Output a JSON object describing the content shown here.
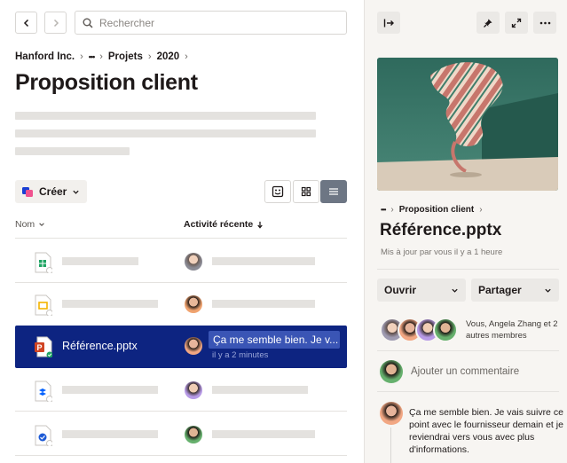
{
  "nav": {
    "back_icon": "chevron-left-icon",
    "forward_icon": "chevron-right-icon"
  },
  "search": {
    "placeholder": "Rechercher",
    "value": "",
    "icon": "search-icon"
  },
  "breadcrumb": {
    "items": [
      "Hanford Inc.",
      "•••",
      "Projets",
      "2020"
    ],
    "separator": "›"
  },
  "page_title": "Proposition client",
  "toolbar": {
    "create_label": "Créer",
    "create_icon": "create-shapes-icon",
    "view_icons": [
      "preview-view-icon",
      "grid-view-icon",
      "list-view-icon"
    ],
    "active_view": "list"
  },
  "table": {
    "columns": [
      {
        "label": "Nom",
        "sort_icon": "chevron-down-icon"
      },
      {
        "label": "Activité récente",
        "sort_icon": "arrow-down-icon"
      }
    ],
    "rows": [
      {
        "icon": "sheets-file-icon",
        "name": "",
        "activity": "",
        "selected": false
      },
      {
        "icon": "slides-file-icon",
        "name": "",
        "activity": "",
        "selected": false
      },
      {
        "icon": "pptx-file-icon",
        "name": "Référence.pptx",
        "activity": "Ça me semble bien. Je v...",
        "time": "il y a 2 minutes",
        "selected": true
      },
      {
        "icon": "dropbox-file-icon",
        "name": "",
        "activity": "",
        "selected": false
      },
      {
        "icon": "shared-file-icon",
        "name": "",
        "activity": "",
        "selected": false
      }
    ]
  },
  "right_panel": {
    "toolbar_icons": [
      "collapse-panel-icon",
      "pin-icon",
      "expand-icon",
      "more-icon"
    ],
    "breadcrumb": {
      "items": [
        "•••",
        "Proposition client"
      ],
      "separator": "›"
    },
    "file_title": "Référence.pptx",
    "subtitle": "Mis à jour par vous il y a 1 heure",
    "open_label": "Ouvrir",
    "share_label": "Partager",
    "members_text": "Vous, Angela Zhang et 2 autres membres",
    "add_comment_placeholder": "Ajouter un commentaire",
    "comment_text": "Ça me semble bien. Je vais suivre ce point avec le fournisseur demain et je reviendrai vers vous avec plus d'informations."
  },
  "colors": {
    "selected_row": "#0d2481",
    "comment_highlight": "#3a55b5",
    "skeleton": "#e4e2df",
    "panel_bg": "#f7f5f2"
  }
}
